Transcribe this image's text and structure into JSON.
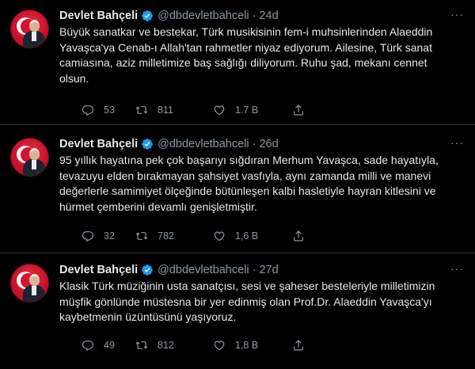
{
  "tweets": [
    {
      "name": "Devlet Bahçeli",
      "handle": "@dbdevletbahceli",
      "time": "24d",
      "text": "Büyük sanatkar ve bestekar, Türk musikisinin fem-i muhsinlerinden Alaeddin Yavaşca'ya Cenab-ı Allah'tan rahmetler niyaz ediyorum. Ailesine, Türk sanat camiasına, aziz milletimize baş sağlığı diliyorum. Ruhu şad, mekanı cennet olsun.",
      "replies": "53",
      "retweets": "811",
      "likes": "1.7 B"
    },
    {
      "name": "Devlet Bahçeli",
      "handle": "@dbdevletbahceli",
      "time": "26d",
      "text": "95 yıllık hayatına pek çok başarıyı sığdıran Merhum Yavaşca, sade hayatıyla, tevazuyu elden bırakmayan şahsiyet vasfıyla, aynı zamanda milli ve manevi değerlerle samimiyet ölçeğinde bütünleşen kalbi hasletiyle hayran kitlesini ve hürmet çemberini devamlı genişletmiştir.",
      "replies": "32",
      "retweets": "782",
      "likes": "1,6 B"
    },
    {
      "name": "Devlet Bahçeli",
      "handle": "@dbdevletbahceli",
      "time": "27d",
      "text": "Klasik Türk müziğinin usta sanatçısı, sesi ve şaheser besteleriyle milletimizin müşfik gönlünde müstesna bir yer edinmiş olan Prof.Dr. Alaeddin Yavaşca'yı kaybetmenin üzüntüsünü yaşıyoruz.",
      "replies": "49",
      "retweets": "812",
      "likes": "1,8 B"
    }
  ],
  "colors": {
    "background": "#000000",
    "text": "#e7e9ea",
    "secondary": "#8b98a5",
    "divider": "#2f3336",
    "verified": "#1d9bf0"
  },
  "icons": [
    "verified-badge-icon",
    "more-icon",
    "reply-icon",
    "retweet-icon",
    "like-icon",
    "share-icon"
  ]
}
